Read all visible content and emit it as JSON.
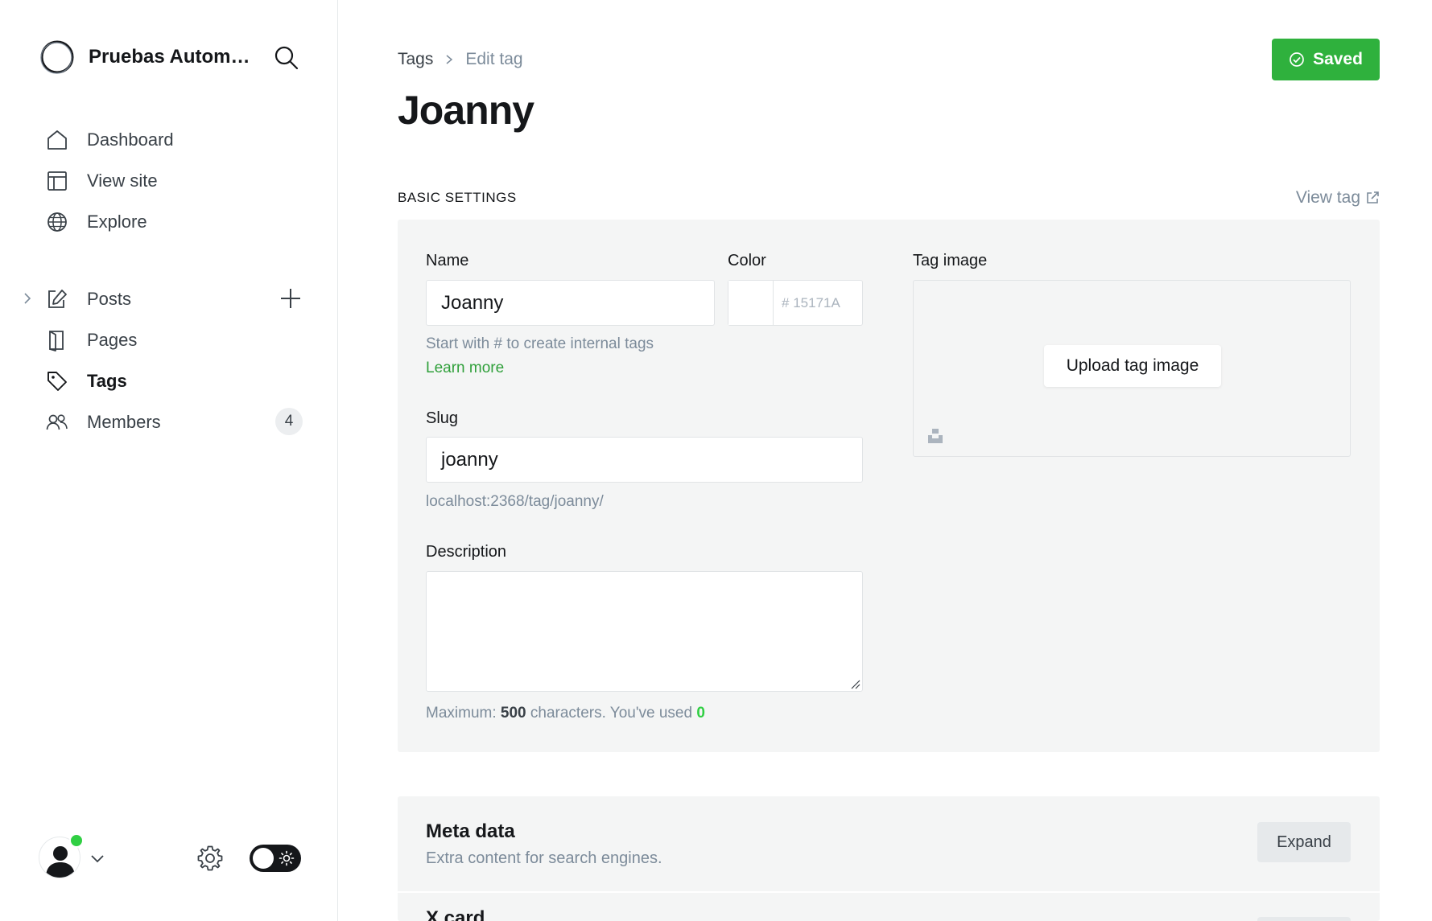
{
  "sidebar": {
    "site_name": "Pruebas Automa...",
    "nav_top": [
      {
        "label": "Dashboard",
        "icon": "home-icon"
      },
      {
        "label": "View site",
        "icon": "layout-icon"
      },
      {
        "label": "Explore",
        "icon": "globe-icon"
      }
    ],
    "nav_content": [
      {
        "label": "Posts",
        "icon": "edit-icon"
      },
      {
        "label": "Pages",
        "icon": "page-icon"
      },
      {
        "label": "Tags",
        "icon": "tag-icon",
        "active": true
      },
      {
        "label": "Members",
        "icon": "members-icon",
        "count": "4"
      }
    ]
  },
  "header": {
    "breadcrumb_parent": "Tags",
    "breadcrumb_current": "Edit tag",
    "title": "Joanny",
    "save_label": "Saved"
  },
  "basic": {
    "section_title": "BASIC SETTINGS",
    "view_tag_label": "View tag",
    "name_label": "Name",
    "name_value": "Joanny",
    "name_hint": "Start with # to create internal tags",
    "learn_more": "Learn more",
    "color_label": "Color",
    "color_hash": "#",
    "color_value": "15171A",
    "slug_label": "Slug",
    "slug_value": "joanny",
    "slug_url": "localhost:2368/tag/joanny/",
    "description_label": "Description",
    "description_value": "",
    "counter_prefix": "Maximum:",
    "counter_max": "500",
    "counter_middle": "characters. You've used",
    "counter_used": "0",
    "image_label": "Tag image",
    "upload_label": "Upload tag image"
  },
  "meta": {
    "title": "Meta data",
    "subtitle": "Extra content for search engines.",
    "expand_label": "Expand",
    "xcard_title": "X card"
  },
  "colors": {
    "accent_green": "#30a03b",
    "saved_green": "#2fb13d",
    "online_dot": "#30cf43",
    "card_bg": "#f4f5f5",
    "muted_text": "#7c8b9a"
  }
}
